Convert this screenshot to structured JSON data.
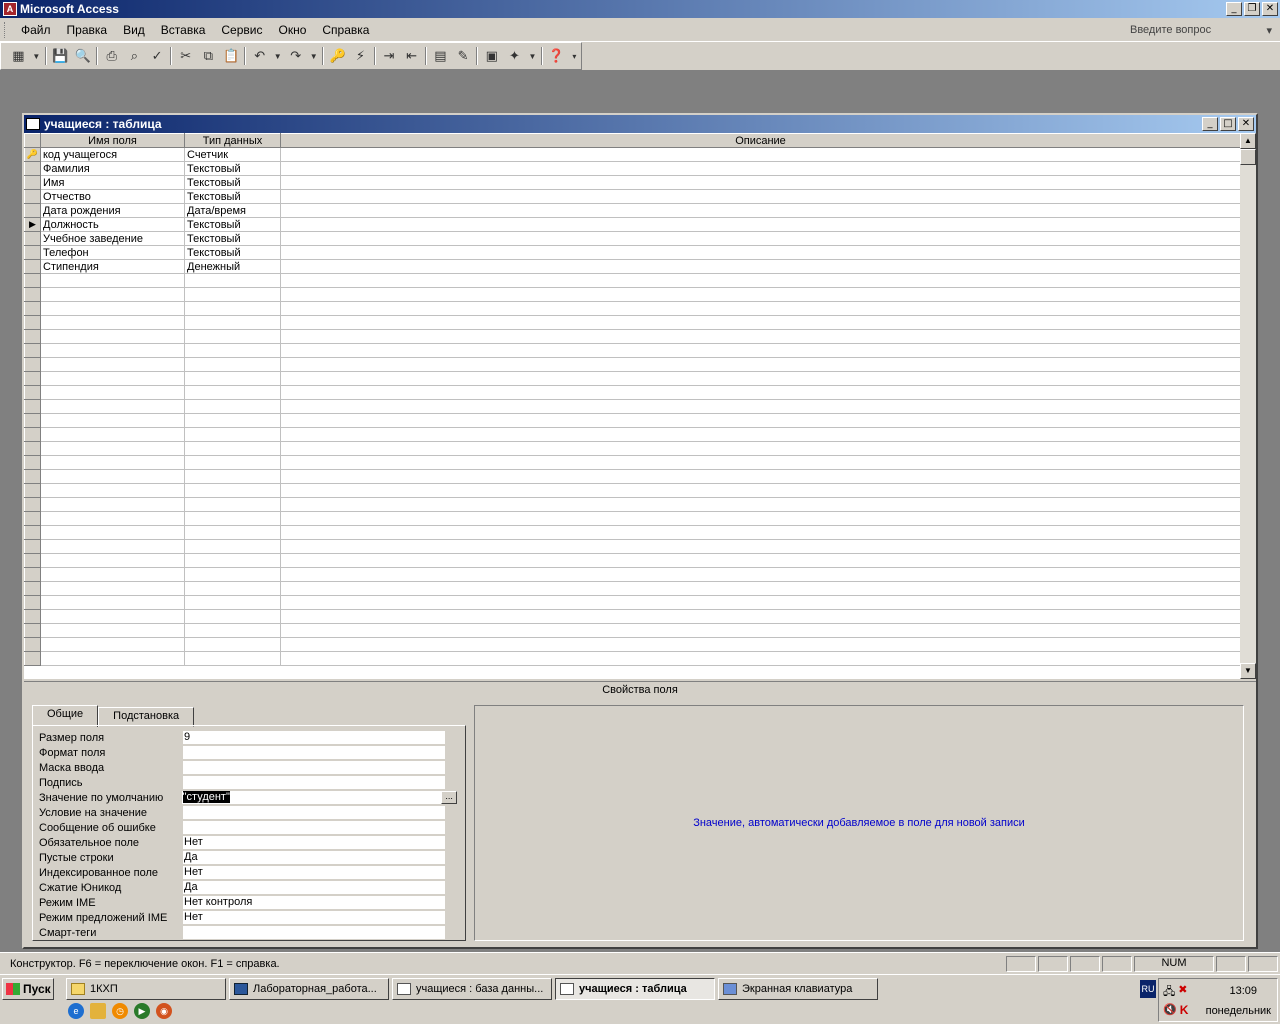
{
  "app": {
    "title": "Microsoft Access",
    "icon_letter": "A"
  },
  "menu": {
    "items": [
      "Файл",
      "Правка",
      "Вид",
      "Вставка",
      "Сервис",
      "Окно",
      "Справка"
    ],
    "help_placeholder": "Введите вопрос"
  },
  "toolbar": {
    "icons": [
      "view-icon",
      "save-icon",
      "search-icon",
      "print-icon",
      "preview-icon",
      "spell-icon",
      "cut-icon",
      "copy-icon",
      "paste-icon",
      "undo-icon",
      "redo-icon",
      "key-icon",
      "index-icon",
      "insert-row-icon",
      "delete-row-icon",
      "properties-icon",
      "build-icon",
      "database-icon",
      "new-object-icon",
      "help-icon"
    ]
  },
  "window": {
    "title": "учащиеся : таблица"
  },
  "grid": {
    "headers": {
      "field": "Имя поля",
      "type": "Тип данных",
      "desc": "Описание"
    },
    "rows": [
      {
        "field": "код учащегося",
        "type": "Счетчик",
        "marker": "key"
      },
      {
        "field": "Фамилия",
        "type": "Текстовый",
        "marker": ""
      },
      {
        "field": "Имя",
        "type": "Текстовый",
        "marker": ""
      },
      {
        "field": "Отчество",
        "type": "Текстовый",
        "marker": ""
      },
      {
        "field": "Дата рождения",
        "type": "Дата/время",
        "marker": ""
      },
      {
        "field": "Должность",
        "type": "Текстовый",
        "marker": "current"
      },
      {
        "field": "Учебное заведение",
        "type": "Текстовый",
        "marker": ""
      },
      {
        "field": "Телефон",
        "type": "Текстовый",
        "marker": ""
      },
      {
        "field": "Стипендия",
        "type": "Денежный",
        "marker": ""
      }
    ]
  },
  "properties": {
    "section_label": "Свойства поля",
    "tabs": [
      "Общие",
      "Подстановка"
    ],
    "rows": [
      {
        "label": "Размер поля",
        "value": "9"
      },
      {
        "label": "Формат поля",
        "value": ""
      },
      {
        "label": "Маска ввода",
        "value": ""
      },
      {
        "label": "Подпись",
        "value": ""
      },
      {
        "label": "Значение по умолчанию",
        "value": "\"студент\"",
        "selected": true
      },
      {
        "label": "Условие на значение",
        "value": ""
      },
      {
        "label": "Сообщение об ошибке",
        "value": ""
      },
      {
        "label": "Обязательное поле",
        "value": "Нет"
      },
      {
        "label": "Пустые строки",
        "value": "Да"
      },
      {
        "label": "Индексированное поле",
        "value": "Нет"
      },
      {
        "label": "Сжатие Юникод",
        "value": "Да"
      },
      {
        "label": "Режим IME",
        "value": "Нет контроля"
      },
      {
        "label": "Режим предложений IME",
        "value": "Нет"
      },
      {
        "label": "Смарт-теги",
        "value": ""
      }
    ],
    "help_text": "Значение, автоматически добавляемое в поле для новой записи"
  },
  "status": {
    "text": "Конструктор.  F6 = переключение окон.  F1 = справка.",
    "num": "NUM"
  },
  "taskbar": {
    "start": "Пуск",
    "tasks": [
      {
        "label": "1КХП",
        "icon": "folder"
      },
      {
        "label": "Лабораторная_работа...",
        "icon": "word"
      },
      {
        "label": "учащиеся : база данны...",
        "icon": "db"
      },
      {
        "label": "учащиеся : таблица",
        "icon": "table",
        "active": true
      },
      {
        "label": "Экранная клавиатура",
        "icon": "keyboard"
      }
    ],
    "lang": "RU",
    "time": "13:09",
    "day": "понедельник"
  }
}
